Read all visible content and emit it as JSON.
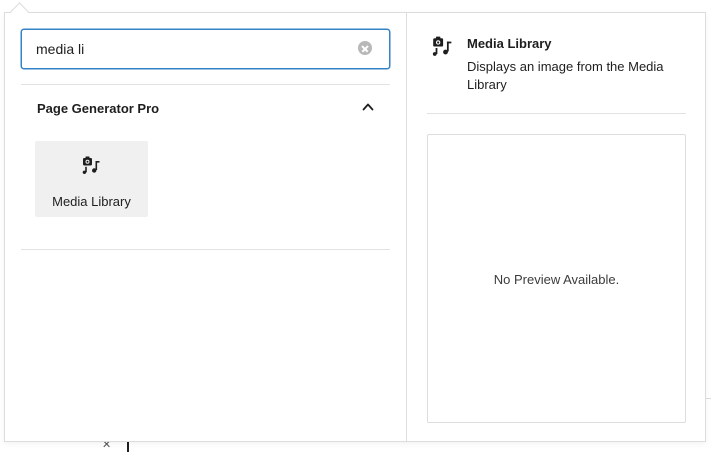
{
  "inserter": {
    "search": {
      "value": "media li",
      "placeholder": "Search"
    },
    "category": {
      "title": "Page Generator Pro"
    },
    "results": [
      {
        "label": "Media Library",
        "icon": "media-library-icon"
      }
    ]
  },
  "preview": {
    "title": "Media Library",
    "description": "Displays an image from the Media Library",
    "empty_text": "No Preview Available.",
    "icon": "media-library-icon"
  },
  "colors": {
    "focus_border": "#3582c4",
    "block_bg": "#f0f0f0",
    "border": "#dddddd"
  }
}
